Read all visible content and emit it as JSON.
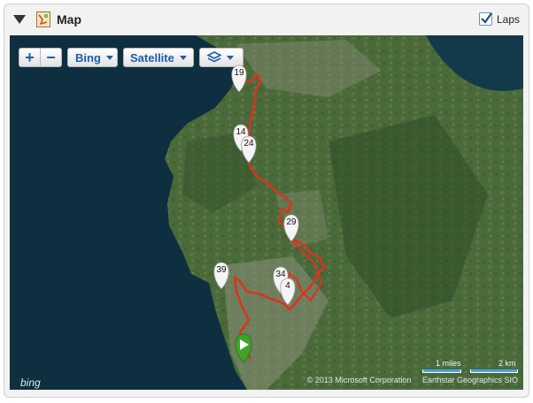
{
  "header": {
    "title": "Map",
    "laps_label": "Laps",
    "laps_checked": true
  },
  "map_controls": {
    "zoom_in": "+",
    "zoom_out": "−",
    "provider": "Bing",
    "map_type": "Satellite"
  },
  "pins": {
    "p19": "19",
    "p14": "14",
    "p24": "24",
    "p29": "29",
    "p39": "39",
    "p34": "34",
    "p4": "4"
  },
  "footer": {
    "logo_text": "bing",
    "copyright": "© 2013 Microsoft Corporation     Earthstar Geographics SIO",
    "scale_miles": "1 miles",
    "scale_km": "2 km"
  },
  "colors": {
    "route": "#e0301e",
    "start_marker": "#3fa32a",
    "control_text": "#1d5ea8"
  }
}
